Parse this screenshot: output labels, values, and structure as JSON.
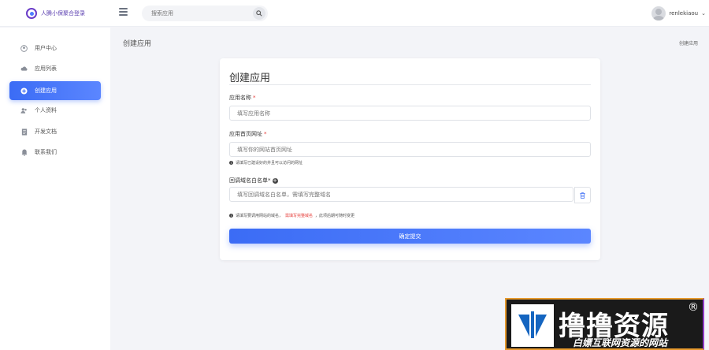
{
  "header": {
    "logo_text": "人腾小保聚合登录",
    "search_placeholder": "搜索应用",
    "username": "renlekiaou",
    "chevron": "⌄"
  },
  "sidebar": {
    "items": [
      {
        "label": "用户中心",
        "icon": "user-circle-icon",
        "active": false
      },
      {
        "label": "应用列表",
        "icon": "cloud-icon",
        "active": false
      },
      {
        "label": "创建应用",
        "icon": "plus-circle-icon",
        "active": true
      },
      {
        "label": "个人资料",
        "icon": "users-icon",
        "active": false
      },
      {
        "label": "开发文档",
        "icon": "document-icon",
        "active": false
      },
      {
        "label": "联系我们",
        "icon": "bell-icon",
        "active": false
      }
    ]
  },
  "main": {
    "page_title": "创建应用",
    "breadcrumb": "创建应用"
  },
  "form": {
    "title": "创建应用",
    "name_label": "应用名称",
    "name_placeholder": "填写应用名称",
    "homepage_label": "应用首页网址",
    "homepage_placeholder": "填写你的网站首页网址",
    "homepage_hint": "请填写已建设好的并且可以访问的网址",
    "callback_label": "回调域名白名单",
    "callback_placeholder": "填写回调域名白名单，需填写完整域名",
    "callback_hint_prefix": "请填写要调用网站的域名，",
    "callback_hint_red": "需填写完整域名",
    "callback_hint_suffix": "，此项后期可随时变更",
    "required_mark": "*",
    "submit_label": "确定提交"
  },
  "watermark": {
    "title": "撸撸资源",
    "subtitle": "白嫖互联网资源的网站",
    "registered": "®"
  },
  "colors": {
    "accent": "#3b6cf5",
    "required": "#e53935",
    "watermark_border_left": "#e69a2e",
    "watermark_border_right": "#8e3bc4"
  }
}
